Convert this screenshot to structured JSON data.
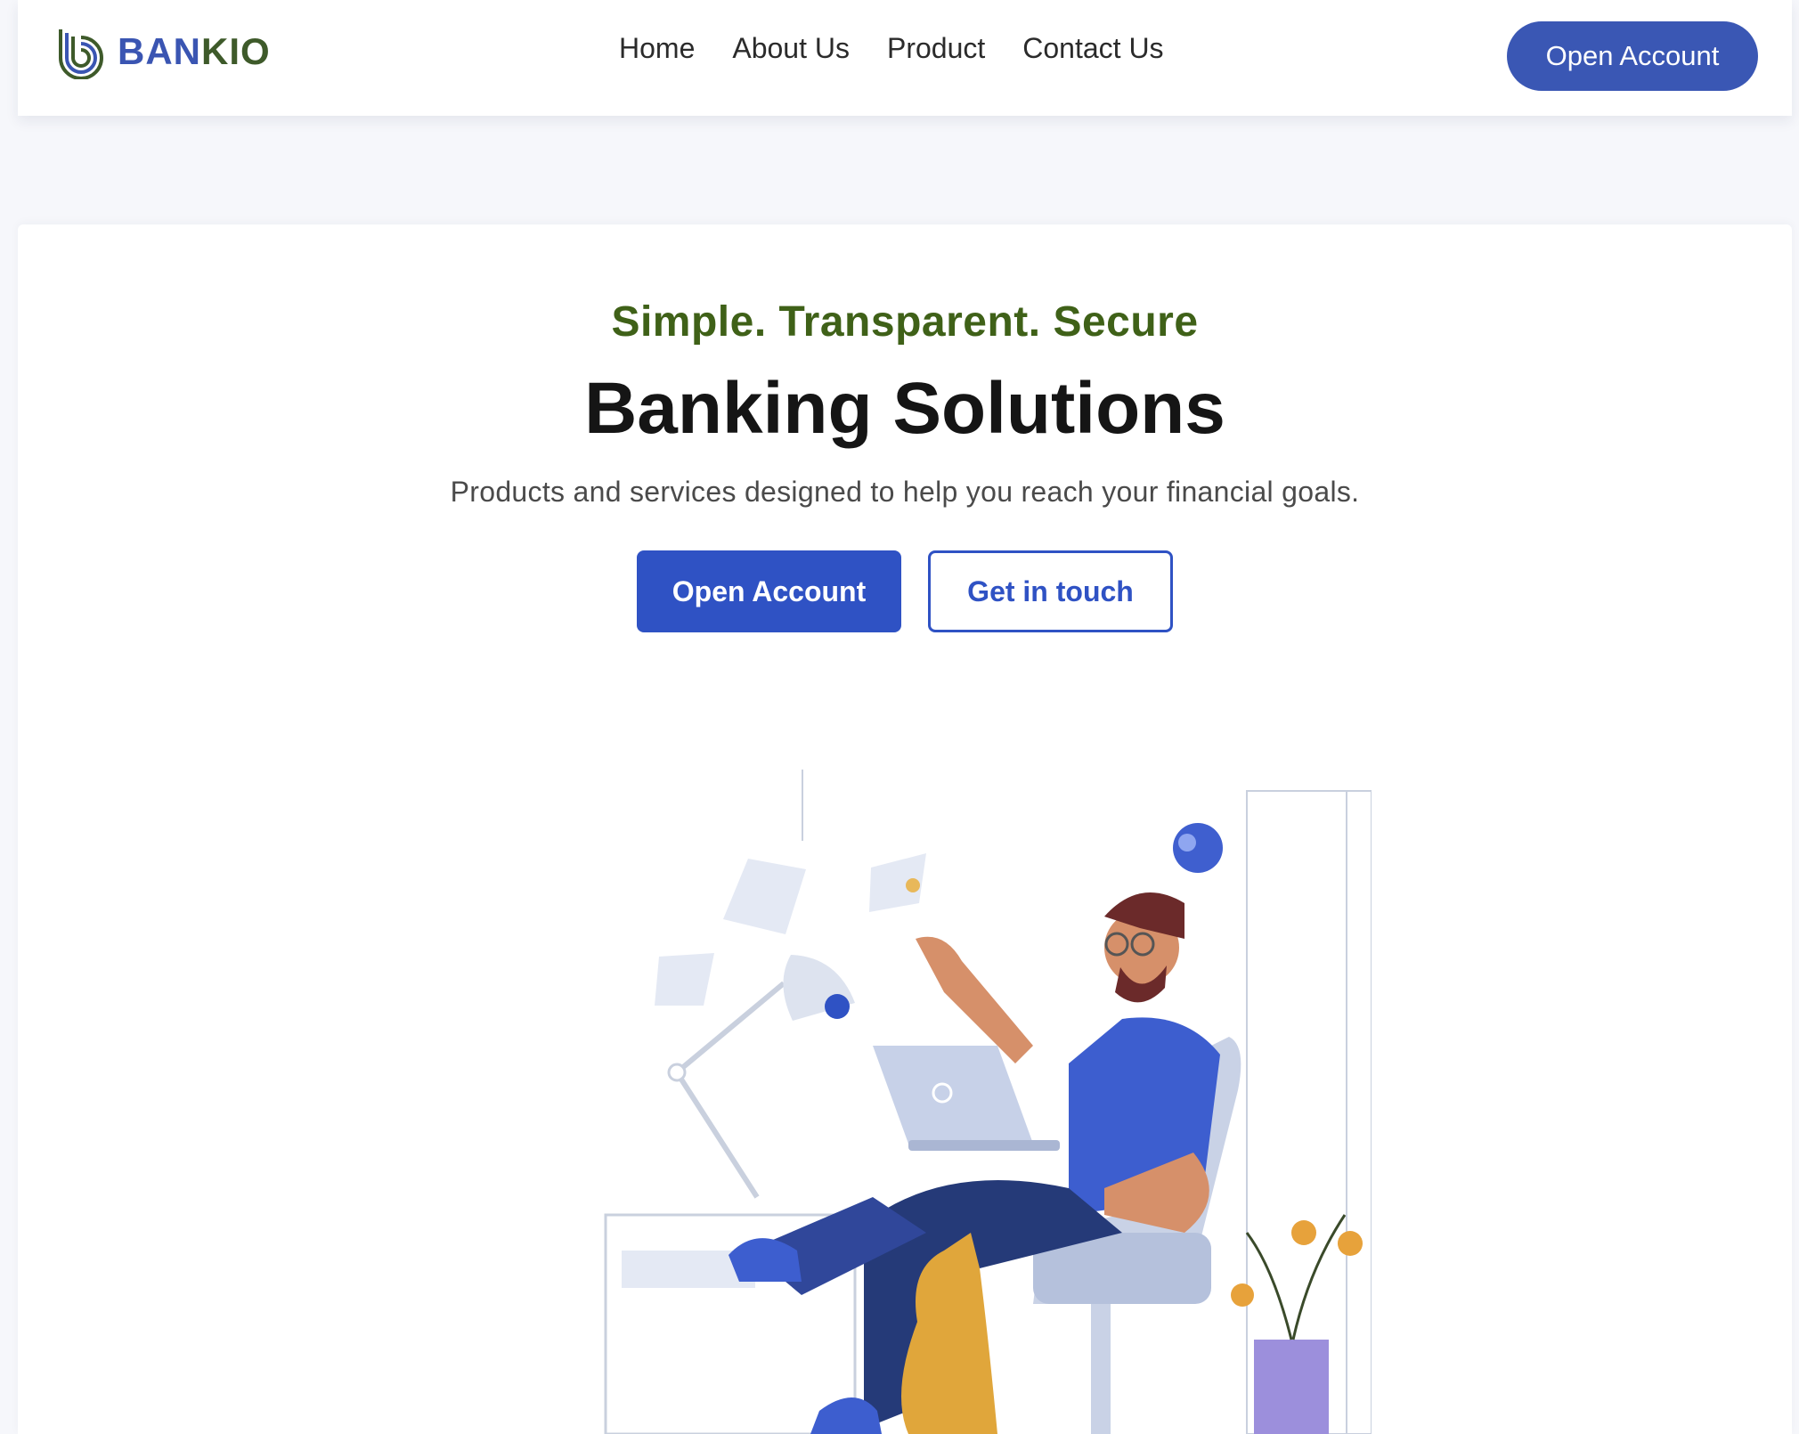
{
  "brand": {
    "name_part1": "BAN",
    "name_part2": "KIO",
    "logo_icon": "bankio-logo-icon"
  },
  "nav": {
    "links": [
      "Home",
      "About Us",
      "Product",
      "Contact Us"
    ],
    "cta_label": "Open Account"
  },
  "hero": {
    "tagline": "Simple. Transparent. Secure",
    "headline": "Banking Solutions",
    "subtext": "Products and services designed to help you reach your financial goals.",
    "primary_button": "Open Account",
    "secondary_button": "Get in touch",
    "illustration": "man-with-laptop-illustration"
  },
  "colors": {
    "brand_blue": "#3a55b2",
    "brand_green": "#3e5a2a",
    "primary_button": "#2f52c4",
    "tagline_green": "#3f6118",
    "page_background": "#f6f7fb"
  }
}
